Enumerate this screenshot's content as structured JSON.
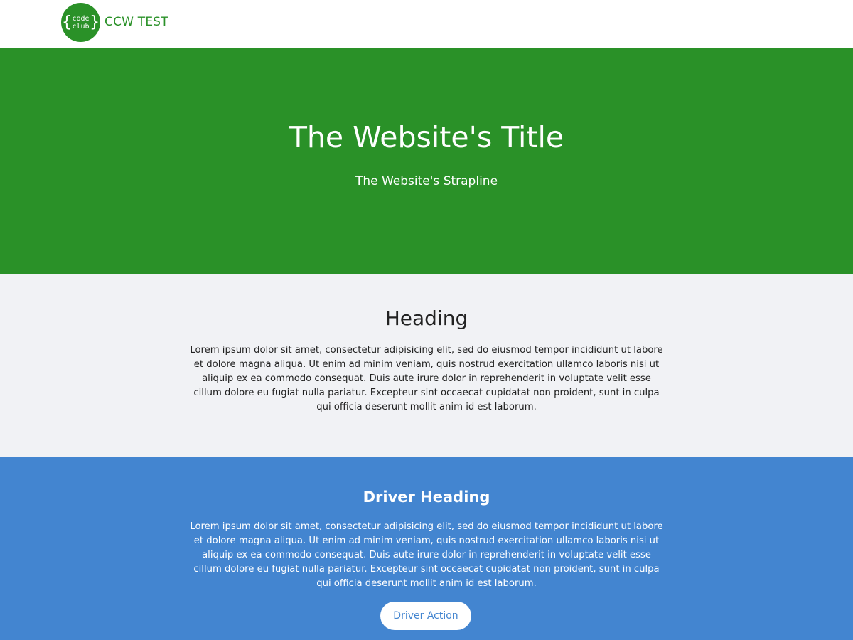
{
  "header": {
    "logo": {
      "line1": "code",
      "line2": "club",
      "left_brace": "{",
      "right_brace": "}",
      "color": "#2a9128"
    },
    "site_name": "CCW TEST"
  },
  "hero": {
    "title": "The Website's Title",
    "strapline": "The Website's Strapline",
    "background": "#2a9128"
  },
  "content_section": {
    "heading": "Heading",
    "body": "Lorem ipsum dolor sit amet, consectetur adipisicing elit, sed do eiusmod tempor incididunt ut labore et dolore magna aliqua. Ut enim ad minim veniam, quis nostrud exercitation ullamco laboris nisi ut aliquip ex ea commodo consequat. Duis aute irure dolor in reprehenderit in voluptate velit esse cillum dolore eu fugiat nulla pariatur. Excepteur sint occaecat cupidatat non proident, sunt in culpa qui officia deserunt mollit anim id est laborum.",
    "background": "#f1f2f5"
  },
  "driver_section": {
    "heading": "Driver Heading",
    "body": "Lorem ipsum dolor sit amet, consectetur adipisicing elit, sed do eiusmod tempor incididunt ut labore et dolore magna aliqua. Ut enim ad minim veniam, quis nostrud exercitation ullamco laboris nisi ut aliquip ex ea commodo consequat. Duis aute irure dolor in reprehenderit in voluptate velit esse cillum dolore eu fugiat nulla pariatur. Excepteur sint occaecat cupidatat non proident, sunt in culpa qui officia deserunt mollit anim id est laborum.",
    "button_label": "Driver Action",
    "background": "#4385d0"
  }
}
